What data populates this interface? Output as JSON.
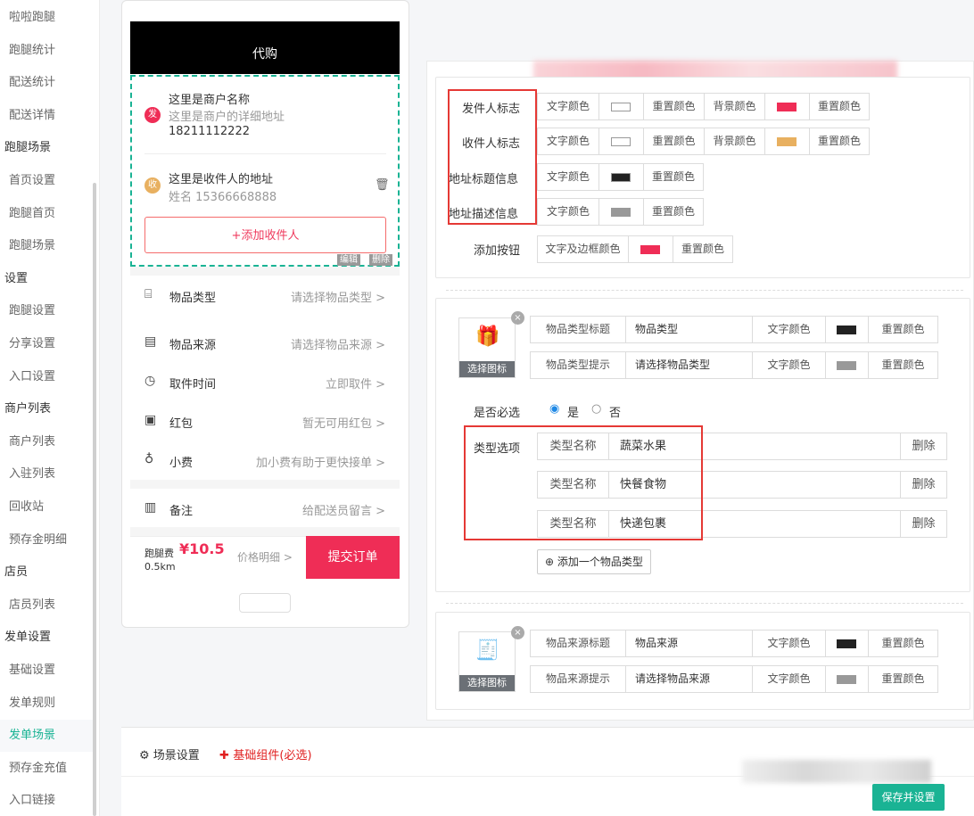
{
  "sidebar": {
    "items": [
      {
        "label": "啦啦跑腿",
        "type": "item"
      },
      {
        "label": "跑腿统计",
        "type": "item"
      },
      {
        "label": "配送统计",
        "type": "item"
      },
      {
        "label": "配送详情",
        "type": "item"
      },
      {
        "label": "跑腿场景",
        "type": "group"
      },
      {
        "label": "首页设置",
        "type": "item"
      },
      {
        "label": "跑腿首页",
        "type": "item"
      },
      {
        "label": "跑腿场景",
        "type": "item"
      },
      {
        "label": "设置",
        "type": "group"
      },
      {
        "label": "跑腿设置",
        "type": "item"
      },
      {
        "label": "分享设置",
        "type": "item"
      },
      {
        "label": "入口设置",
        "type": "item"
      },
      {
        "label": "商户列表",
        "type": "group"
      },
      {
        "label": "商户列表",
        "type": "item"
      },
      {
        "label": "入驻列表",
        "type": "item"
      },
      {
        "label": "回收站",
        "type": "item"
      },
      {
        "label": "预存金明细",
        "type": "item"
      },
      {
        "label": "店员",
        "type": "group"
      },
      {
        "label": "店员列表",
        "type": "item"
      },
      {
        "label": "发单设置",
        "type": "group"
      },
      {
        "label": "基础设置",
        "type": "item"
      },
      {
        "label": "发单规则",
        "type": "item"
      },
      {
        "label": "发单场景",
        "type": "item",
        "active": true
      },
      {
        "label": "预存金充值",
        "type": "item"
      },
      {
        "label": "入口链接",
        "type": "item"
      }
    ]
  },
  "preview": {
    "header_title": "代购",
    "sender": {
      "badge": "发",
      "name": "这里是商户名称",
      "address": "这里是商户的详细地址",
      "phone": "18211112222"
    },
    "receiver": {
      "badge": "收",
      "address": "这里是收件人的地址",
      "contact": "姓名 15366668888"
    },
    "add_receiver": "+添加收件人",
    "edit_label": "编辑",
    "delete_label": "删除",
    "rows": [
      {
        "icon": "gift-icon",
        "glyph": "⌸",
        "label": "物品类型",
        "value": "请选择物品类型 >"
      },
      {
        "icon": "receipt-icon",
        "glyph": "▤",
        "label": "物品来源",
        "value": "请选择物品来源 >"
      },
      {
        "icon": "clock-icon",
        "glyph": "◷",
        "label": "取件时间",
        "value": "立即取件 >"
      },
      {
        "icon": "red-packet-icon",
        "glyph": "▣",
        "label": "红包",
        "value": "暂无可用红包 >"
      },
      {
        "icon": "money-bag-icon",
        "glyph": "♁",
        "label": "小费",
        "value": "加小费有助于更快接单 >"
      },
      {
        "icon": "note-icon",
        "glyph": "▥",
        "label": "备注",
        "value": "给配送员留言 >"
      }
    ],
    "fee_label": "跑腿费",
    "fee_amount": "¥10.5",
    "distance": "0.5km",
    "price_detail": "价格明细 >",
    "submit": "提交订单"
  },
  "address_settings": {
    "rows": [
      {
        "label": "发件人标志",
        "text_color_label": "文字颜色",
        "text_color": "#ffffff",
        "reset1": "重置颜色",
        "bg_label": "背景颜色",
        "bg_color": "#ef2d56",
        "reset2": "重置颜色"
      },
      {
        "label": "收件人标志",
        "text_color_label": "文字颜色",
        "text_color": "#ffffff",
        "reset1": "重置颜色",
        "bg_label": "背景颜色",
        "bg_color": "#e8b060",
        "reset2": "重置颜色"
      },
      {
        "label": "地址标题信息",
        "text_color_label": "文字颜色",
        "text_color": "#222222",
        "reset1": "重置颜色"
      },
      {
        "label": "地址描述信息",
        "text_color_label": "文字颜色",
        "text_color": "#999999",
        "reset1": "重置颜色"
      }
    ],
    "add_button": {
      "label": "添加按钮",
      "color_label": "文字及边框颜色",
      "color": "#ef2d56",
      "reset": "重置颜色"
    }
  },
  "type_settings": {
    "choose_icon": "选择图标",
    "title_label": "物品类型标题",
    "title_value": "物品类型",
    "hint_label": "物品类型提示",
    "hint_value": "请选择物品类型",
    "text_color_label": "文字颜色",
    "title_color": "#222222",
    "hint_color": "#999999",
    "reset": "重置颜色",
    "required_label": "是否必选",
    "yes": "是",
    "no": "否",
    "options_label": "类型选项",
    "options": [
      {
        "key": "类型名称",
        "value": "蔬菜水果",
        "delete": "删除"
      },
      {
        "key": "类型名称",
        "value": "快餐食物",
        "delete": "删除"
      },
      {
        "key": "类型名称",
        "value": "快递包裹",
        "delete": "删除"
      }
    ],
    "add_type": "添加一个物品类型"
  },
  "source_settings": {
    "choose_icon": "选择图标",
    "title_label": "物品来源标题",
    "title_value": "物品来源",
    "hint_label": "物品来源提示",
    "hint_value": "请选择物品来源",
    "text_color_label": "文字颜色",
    "title_color": "#222222",
    "hint_color": "#999999",
    "reset": "重置颜色"
  },
  "footer": {
    "scene_settings": "场景设置",
    "basic_components": "基础组件(必选)",
    "save": "保存并设置"
  },
  "colors": {
    "accent": "#1ab394",
    "brand_red": "#ef2d56",
    "highlight_box": "#e53935"
  }
}
